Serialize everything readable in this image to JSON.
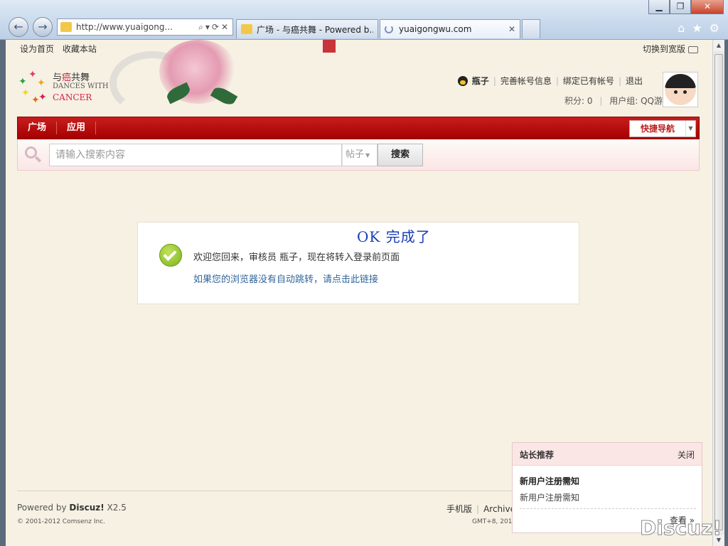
{
  "browser": {
    "address": "http://www.yuaigong...",
    "tabs": [
      {
        "title": "广场 - 与癌共舞 - Powered b..."
      },
      {
        "title": "yuaigongwu.com"
      }
    ],
    "close_glyph": "✕",
    "tab_close_glyph": "✕"
  },
  "site": {
    "top_links": [
      "设为首页",
      "收藏本站"
    ],
    "wide_switch": "切换到宽版",
    "logo": {
      "cn_prefix": "与",
      "cn_red": "癌",
      "cn_suffix": "共舞",
      "en_line1": "DANCES WITH",
      "en_line2": "CANCER"
    },
    "user": {
      "name": "瓶子",
      "links": [
        "完善帐号信息",
        "绑定已有帐号",
        "退出"
      ],
      "points": "积分: 0",
      "group": "用户组: QQ游客"
    },
    "nav": {
      "items": [
        "广场",
        "应用"
      ],
      "quick_nav": "快捷导航"
    },
    "search": {
      "placeholder": "请输入搜索内容",
      "type": "帖子",
      "button": "搜索"
    }
  },
  "message": {
    "title": "OK  完成了",
    "line1": "欢迎您回来，审核员 瓶子，现在将转入登录前页面",
    "line2": "如果您的浏览器没有自动跳转，请点击此链接"
  },
  "footer": {
    "powered_prefix": "Powered by ",
    "powered_brand": "Discuz!",
    "powered_version": " X2.5",
    "copyright": "© 2001-2012 Comsenz Inc.",
    "links": [
      "手机版",
      "Archive"
    ],
    "gmt": "GMT+8, 201"
  },
  "recommend": {
    "header": "站长推荐",
    "close": "关闭",
    "title": "新用户注册需知",
    "desc": "新用户注册需知",
    "view": "查看 »"
  },
  "watermark": "Discuz!",
  "colors": {
    "nav_red": "#b80f0f",
    "link_blue": "#336699",
    "title_blue": "#1a3db6",
    "ok_green": "#7ab51d"
  }
}
